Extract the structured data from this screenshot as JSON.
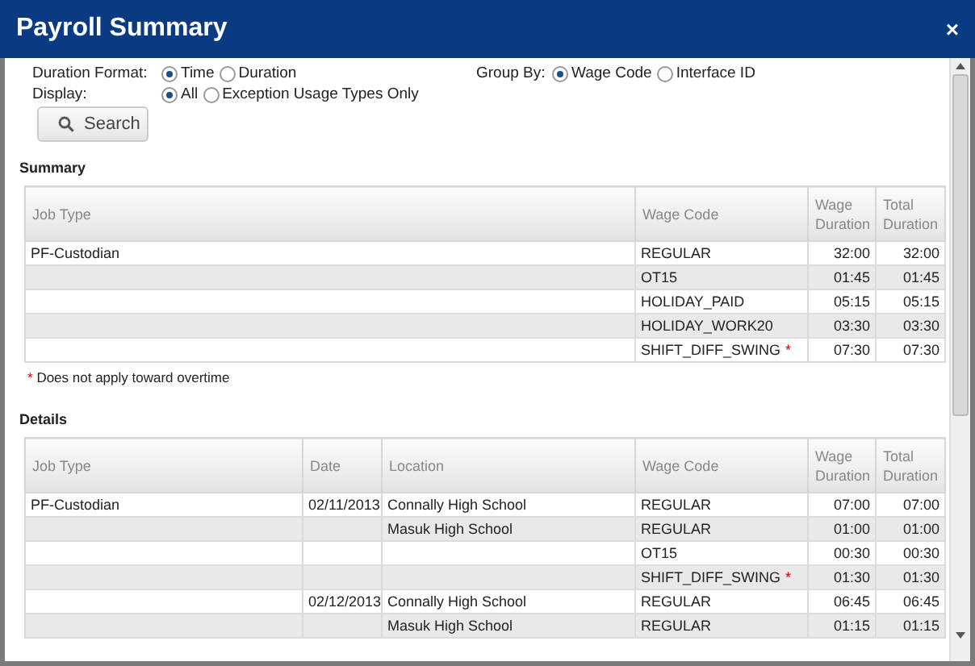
{
  "window": {
    "title": "Payroll Summary",
    "close": "×"
  },
  "filters": [
    {
      "label": "Duration Format:",
      "options": [
        {
          "label": "Time",
          "selected": true
        },
        {
          "label": "Duration",
          "selected": false
        }
      ]
    },
    {
      "label": "Display:",
      "options": [
        {
          "label": "All",
          "selected": true
        },
        {
          "label": "Exception Usage Types Only",
          "selected": false
        }
      ]
    }
  ],
  "group_by": {
    "label": "Group By:",
    "options": [
      {
        "label": "Wage Code",
        "selected": true
      },
      {
        "label": "Interface ID",
        "selected": false
      }
    ]
  },
  "search_button": "Search",
  "summary": {
    "title": "Summary",
    "columns": [
      "Job Type",
      "Wage Code",
      "Wage Duration",
      "Total Duration"
    ],
    "rows": [
      {
        "cells": [
          "PF-Custodian",
          "REGULAR",
          "32:00",
          "32:00"
        ]
      },
      {
        "cells": [
          "",
          "OT15",
          "01:45",
          "01:45"
        ]
      },
      {
        "cells": [
          "",
          "HOLIDAY_PAID",
          "05:15",
          "05:15"
        ]
      },
      {
        "cells": [
          "",
          "HOLIDAY_WORK20",
          "03:30",
          "03:30"
        ]
      },
      {
        "cells": [
          "",
          "SHIFT_DIFF_SWING",
          "07:30",
          "07:30"
        ],
        "marker": "*"
      }
    ],
    "footnote": {
      "mark": "*",
      "text": "Does not apply toward overtime"
    }
  },
  "details": {
    "title": "Details",
    "columns": [
      "Job Type",
      "Date",
      "Location",
      "Wage Code",
      "Wage Duration",
      "Total Duration"
    ],
    "rows": [
      {
        "cells": [
          "PF-Custodian",
          "02/11/2013",
          "Connally High School",
          "REGULAR",
          "07:00",
          "07:00"
        ]
      },
      {
        "cells": [
          "",
          "",
          "Masuk High School",
          "REGULAR",
          "01:00",
          "01:00"
        ]
      },
      {
        "cells": [
          "",
          "",
          "",
          "OT15",
          "00:30",
          "00:30"
        ]
      },
      {
        "cells": [
          "",
          "",
          "",
          "SHIFT_DIFF_SWING",
          "01:30",
          "01:30"
        ],
        "marker": "*"
      },
      {
        "cells": [
          "",
          "02/12/2013",
          "Connally High School",
          "REGULAR",
          "06:45",
          "06:45"
        ]
      },
      {
        "cells": [
          "",
          "",
          "Masuk High School",
          "REGULAR",
          "01:15",
          "01:15"
        ]
      }
    ]
  }
}
